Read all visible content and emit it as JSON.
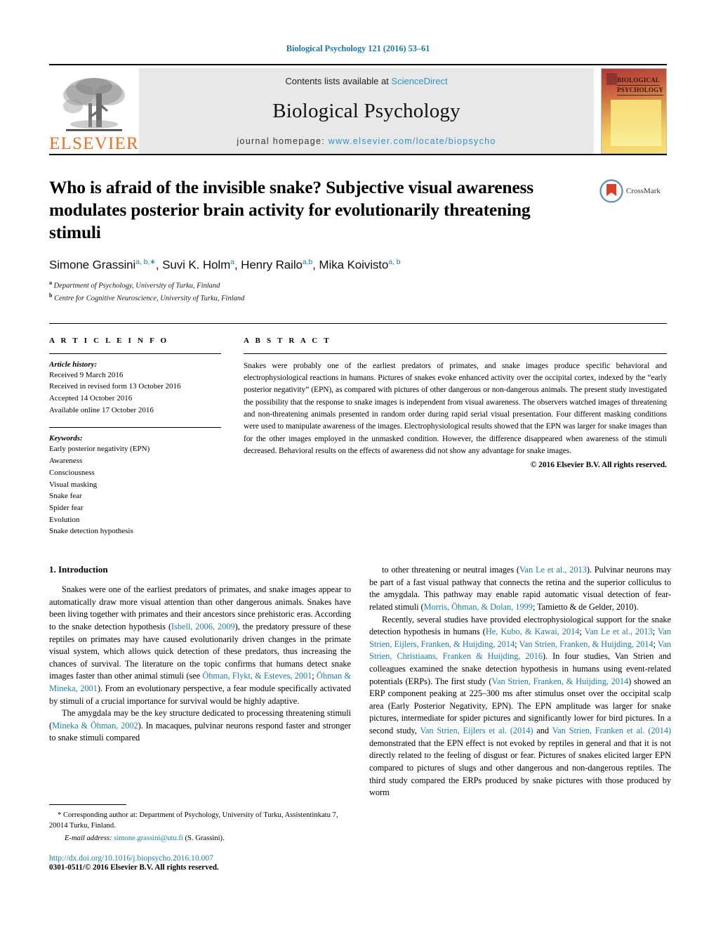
{
  "running_head": "Biological Psychology 121 (2016) 53–61",
  "masthead": {
    "contents_prefix": "Contents lists available at ",
    "contents_link": "ScienceDirect",
    "journal_name": "Biological Psychology",
    "homepage_label": "journal homepage:",
    "homepage_url": "www.elsevier.com/locate/biopsycho",
    "publisher_wordmark": "ELSEVIER",
    "cover_title_line1": "BIOLOGICAL",
    "cover_title_line2": "PSYCHOLOGY"
  },
  "article": {
    "title": "Who is afraid of the invisible snake? Subjective visual awareness modulates posterior brain activity for evolutionarily threatening stimuli",
    "crossmark_label": "CrossMark",
    "authors_html": "Simone Grassini<sup>a, b,∗</sup>, Suvi K. Holm<sup>a</sup>, Henry Railo<sup>a,b</sup>, Mika Koivisto<sup>a, b</sup>",
    "affiliations": [
      {
        "marker": "a",
        "text": "Department of Psychology, University of Turku, Finland"
      },
      {
        "marker": "b",
        "text": "Centre for Cognitive Neuroscience, University of Turku, Finland"
      }
    ]
  },
  "info": {
    "heading": "A R T I C L E   I N F O",
    "history_label": "Article history:",
    "history": [
      "Received 9 March 2016",
      "Received in revised form 13 October 2016",
      "Accepted 14 October 2016",
      "Available online 17 October 2016"
    ],
    "keywords_label": "Keywords:",
    "keywords": [
      "Early posterior negativity (EPN)",
      "Awareness",
      "Consciousness",
      "Visual masking",
      "Snake fear",
      "Spider fear",
      "Evolution",
      "Snake detection hypothesis"
    ]
  },
  "abstract": {
    "heading": "A B S T R A C T",
    "text": "Snakes were probably one of the earliest predators of primates, and snake images produce specific behavioral and electrophysiological reactions in humans. Pictures of snakes evoke enhanced activity over the occipital cortex, indexed by the “early posterior negativity” (EPN), as compared with pictures of other dangerous or non-dangerous animals. The present study investigated the possibility that the response to snake images is independent from visual awareness. The observers watched images of threatening and non-threatening animals presented in random order during rapid serial visual presentation. Four different masking conditions were used to manipulate awareness of the images. Electrophysiological results showed that the EPN was larger for snake images than for the other images employed in the unmasked condition. However, the difference disappeared when awareness of the stimuli decreased. Behavioral results on the effects of awareness did not show any advantage for snake images.",
    "copyright": "© 2016 Elsevier B.V. All rights reserved."
  },
  "body": {
    "section_number_title": "1.  Introduction",
    "left_paragraphs": [
      "Snakes were one of the earliest predators of primates, and snake images appear to automatically draw more visual attention than other dangerous animals. Snakes have been living together with primates and their ancestors since prehistoric eras. According to the snake detection hypothesis (@Isbell, 2006, 2009@), the predatory pressure of these reptiles on primates may have caused evolutionarily driven changes in the primate visual system, which allows quick detection of these predators, thus increasing the chances of survival. The literature on the topic confirms that humans detect snake images faster than other animal stimuli (see @Öhman, Flykt, & Esteves, 2001@; @Öhman & Mineka, 2001@). From an evolutionary perspective, a fear module specifically activated by stimuli of a crucial importance for survival would be highly adaptive.",
      "The amygdala may be the key structure dedicated to processing threatening stimuli (@Mineka & Öhman, 2002@). In macaques, pulvinar neurons respond faster and stronger to snake stimuli compared"
    ],
    "right_paragraphs": [
      "to other threatening or neutral images (@Van Le et al., 2013@). Pulvinar neurons may be part of a fast visual pathway that connects the retina and the superior colliculus to the amygdala. This pathway may enable rapid automatic visual detection of fear-related stimuli (@Morris, Öhman, & Dolan, 1999@; Tamietto & de Gelder, 2010).",
      "Recently, several studies have provided electrophysiological support for the snake detection hypothesis in humans (@He, Kubo, & Kawai, 2014@; @Van Le et al., 2013@; @Van Strien, Eijlers, Franken, & Huijding, 2014@; @Van Strien, Franken, & Huijding, 2014@; @Van Strien, Christiaans, Franken & Huijding, 2016@). In four studies, Van Strien and colleagues examined the snake detection hypothesis in humans using event-related potentials (ERPs). The first study (@Van Strien, Franken, & Huijding, 2014@) showed an ERP component peaking at 225–300 ms after stimulus onset over the occipital scalp area (Early Posterior Negativity, EPN). The EPN amplitude was larger for snake pictures, intermediate for spider pictures and significantly lower for bird pictures. In a second study, @Van Strien, Eijlers et al. (2014)@ and @Van Strien, Franken et al. (2014)@ demonstrated that the EPN effect is not evoked by reptiles in general and that it is not directly related to the feeling of disgust or fear. Pictures of snakes elicited larger EPN compared to pictures of slugs and other dangerous and non-dangerous reptiles. The third study compared the ERPs produced by snake pictures with those produced by worm"
    ]
  },
  "footnotes": {
    "corresponding": "* Corresponding author at: Department of Psychology, University of Turku, Assistentinkatu 7, 20014 Turku, Finland.",
    "email_label": "E-mail address:",
    "email": "simone.grassini@utu.fi",
    "email_suffix": "(S. Grassini)."
  },
  "footer": {
    "doi": "http://dx.doi.org/10.1016/j.biopsycho.2016.10.007",
    "issn": "0301-0511/© 2016 Elsevier B.V. All rights reserved."
  },
  "colors": {
    "link": "#1a7fa8",
    "sciencedirect": "#2a93c9",
    "elsevier_orange": "#f06f1e"
  }
}
